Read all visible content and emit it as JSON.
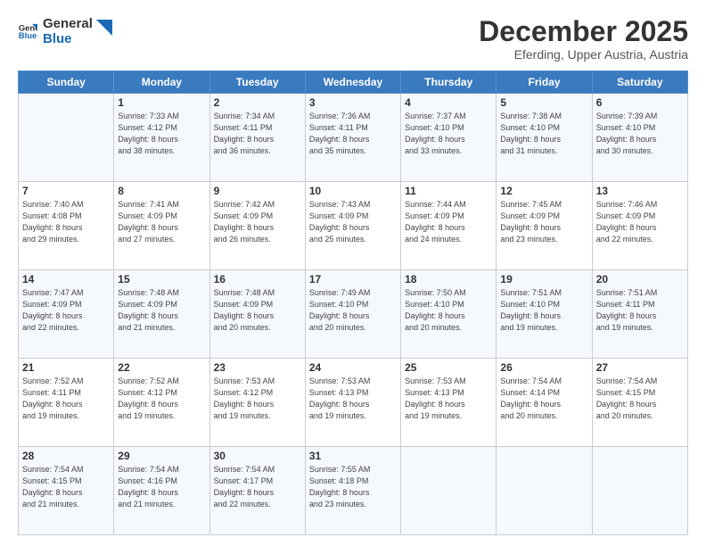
{
  "header": {
    "logo_general": "General",
    "logo_blue": "Blue",
    "month_title": "December 2025",
    "location": "Eferding, Upper Austria, Austria"
  },
  "days_of_week": [
    "Sunday",
    "Monday",
    "Tuesday",
    "Wednesday",
    "Thursday",
    "Friday",
    "Saturday"
  ],
  "weeks": [
    [
      {
        "day": "",
        "info": ""
      },
      {
        "day": "1",
        "info": "Sunrise: 7:33 AM\nSunset: 4:12 PM\nDaylight: 8 hours\nand 38 minutes."
      },
      {
        "day": "2",
        "info": "Sunrise: 7:34 AM\nSunset: 4:11 PM\nDaylight: 8 hours\nand 36 minutes."
      },
      {
        "day": "3",
        "info": "Sunrise: 7:36 AM\nSunset: 4:11 PM\nDaylight: 8 hours\nand 35 minutes."
      },
      {
        "day": "4",
        "info": "Sunrise: 7:37 AM\nSunset: 4:10 PM\nDaylight: 8 hours\nand 33 minutes."
      },
      {
        "day": "5",
        "info": "Sunrise: 7:38 AM\nSunset: 4:10 PM\nDaylight: 8 hours\nand 31 minutes."
      },
      {
        "day": "6",
        "info": "Sunrise: 7:39 AM\nSunset: 4:10 PM\nDaylight: 8 hours\nand 30 minutes."
      }
    ],
    [
      {
        "day": "7",
        "info": "Sunrise: 7:40 AM\nSunset: 4:08 PM\nDaylight: 8 hours\nand 29 minutes."
      },
      {
        "day": "8",
        "info": "Sunrise: 7:41 AM\nSunset: 4:09 PM\nDaylight: 8 hours\nand 27 minutes."
      },
      {
        "day": "9",
        "info": "Sunrise: 7:42 AM\nSunset: 4:09 PM\nDaylight: 8 hours\nand 26 minutes."
      },
      {
        "day": "10",
        "info": "Sunrise: 7:43 AM\nSunset: 4:09 PM\nDaylight: 8 hours\nand 25 minutes."
      },
      {
        "day": "11",
        "info": "Sunrise: 7:44 AM\nSunset: 4:09 PM\nDaylight: 8 hours\nand 24 minutes."
      },
      {
        "day": "12",
        "info": "Sunrise: 7:45 AM\nSunset: 4:09 PM\nDaylight: 8 hours\nand 23 minutes."
      },
      {
        "day": "13",
        "info": "Sunrise: 7:46 AM\nSunset: 4:09 PM\nDaylight: 8 hours\nand 22 minutes."
      }
    ],
    [
      {
        "day": "14",
        "info": "Sunrise: 7:47 AM\nSunset: 4:09 PM\nDaylight: 8 hours\nand 22 minutes."
      },
      {
        "day": "15",
        "info": "Sunrise: 7:48 AM\nSunset: 4:09 PM\nDaylight: 8 hours\nand 21 minutes."
      },
      {
        "day": "16",
        "info": "Sunrise: 7:48 AM\nSunset: 4:09 PM\nDaylight: 8 hours\nand 20 minutes."
      },
      {
        "day": "17",
        "info": "Sunrise: 7:49 AM\nSunset: 4:10 PM\nDaylight: 8 hours\nand 20 minutes."
      },
      {
        "day": "18",
        "info": "Sunrise: 7:50 AM\nSunset: 4:10 PM\nDaylight: 8 hours\nand 20 minutes."
      },
      {
        "day": "19",
        "info": "Sunrise: 7:51 AM\nSunset: 4:10 PM\nDaylight: 8 hours\nand 19 minutes."
      },
      {
        "day": "20",
        "info": "Sunrise: 7:51 AM\nSunset: 4:11 PM\nDaylight: 8 hours\nand 19 minutes."
      }
    ],
    [
      {
        "day": "21",
        "info": "Sunrise: 7:52 AM\nSunset: 4:11 PM\nDaylight: 8 hours\nand 19 minutes."
      },
      {
        "day": "22",
        "info": "Sunrise: 7:52 AM\nSunset: 4:12 PM\nDaylight: 8 hours\nand 19 minutes."
      },
      {
        "day": "23",
        "info": "Sunrise: 7:53 AM\nSunset: 4:12 PM\nDaylight: 8 hours\nand 19 minutes."
      },
      {
        "day": "24",
        "info": "Sunrise: 7:53 AM\nSunset: 4:13 PM\nDaylight: 8 hours\nand 19 minutes."
      },
      {
        "day": "25",
        "info": "Sunrise: 7:53 AM\nSunset: 4:13 PM\nDaylight: 8 hours\nand 19 minutes."
      },
      {
        "day": "26",
        "info": "Sunrise: 7:54 AM\nSunset: 4:14 PM\nDaylight: 8 hours\nand 20 minutes."
      },
      {
        "day": "27",
        "info": "Sunrise: 7:54 AM\nSunset: 4:15 PM\nDaylight: 8 hours\nand 20 minutes."
      }
    ],
    [
      {
        "day": "28",
        "info": "Sunrise: 7:54 AM\nSunset: 4:15 PM\nDaylight: 8 hours\nand 21 minutes."
      },
      {
        "day": "29",
        "info": "Sunrise: 7:54 AM\nSunset: 4:16 PM\nDaylight: 8 hours\nand 21 minutes."
      },
      {
        "day": "30",
        "info": "Sunrise: 7:54 AM\nSunset: 4:17 PM\nDaylight: 8 hours\nand 22 minutes."
      },
      {
        "day": "31",
        "info": "Sunrise: 7:55 AM\nSunset: 4:18 PM\nDaylight: 8 hours\nand 23 minutes."
      },
      {
        "day": "",
        "info": ""
      },
      {
        "day": "",
        "info": ""
      },
      {
        "day": "",
        "info": ""
      }
    ]
  ]
}
